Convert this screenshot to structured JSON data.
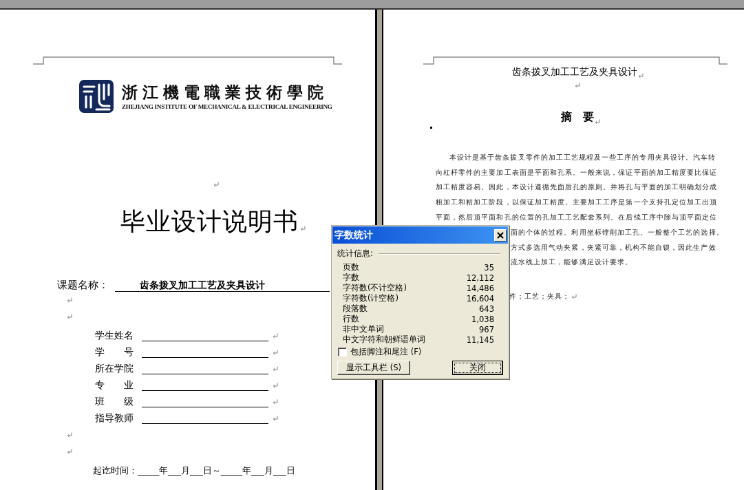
{
  "left_page": {
    "blocks": [
      {
        "kind": "logo",
        "name_cn": "浙江機電職業技術學院",
        "name_en": "ZHEJIANG INSTITUTE OF MECHANICAL & ELECTRICAL ENGINEERING"
      },
      {
        "kind": "center_mark"
      },
      {
        "kind": "title",
        "text": "毕业设计说明书"
      },
      {
        "kind": "topic",
        "label": "课题名称：",
        "value": "齿条拨叉加工工艺及夹具设计"
      },
      {
        "kind": "mark"
      },
      {
        "kind": "mark"
      },
      {
        "kind": "form",
        "fields": [
          {
            "label": "学生姓名"
          },
          {
            "label": "学　　号"
          },
          {
            "label": "所在学院"
          },
          {
            "label": "专　　业"
          },
          {
            "label": "班　　级"
          },
          {
            "label": "指导教师"
          }
        ]
      },
      {
        "kind": "mark"
      },
      {
        "kind": "mark"
      },
      {
        "kind": "dates",
        "text": "起讫时间：_____年___月___日～_____年___月___日"
      }
    ]
  },
  "right_page": {
    "title": "齿条拨叉加工工艺及夹具设计",
    "heading": "摘　要",
    "abstract_lines": [
      {
        "kind": "first",
        "text": "本设计是基于齿条拨叉零件的加工工艺规程及一些工序的专用夹具设计。汽车转"
      },
      {
        "kind": "full",
        "text": "向杠杆零件的主要加工表面是平面和孔系。一般来说，保证平面的加工精度要比保证"
      },
      {
        "kind": "full",
        "text": "加工精度容易。因此，本设计遵循先面后孔的原则。并将孔与平面的加工明确划分成"
      },
      {
        "kind": "full",
        "text": "粗加工和精加工阶段，以保证加工精度。主要加工工序是第一个支持孔定位加工出顶"
      },
      {
        "kind": "full",
        "text": "平面，然后顶平面和孔的位置的孔加工工艺配套系列。在后续工序中除与顶平面定位"
      },
      {
        "kind": "partial",
        "text": "面的个体的过程。利用坐标镗削加工孔。一般整个工艺的选择。"
      },
      {
        "kind": "partial",
        "text": "方式多选用气动夹紧，夹紧可靠，机构不能自锁，因此生产效"
      },
      {
        "kind": "partial",
        "text": "流水线上加工，能够满足设计要求。"
      }
    ],
    "keywords": "件；工艺；夹具；"
  },
  "dialog": {
    "title": "字数统计",
    "section": "统计信息:",
    "stats": [
      {
        "label": "页数",
        "value": "35"
      },
      {
        "label": "字数",
        "value": "12,112"
      },
      {
        "label": "字符数(不计空格)",
        "value": "14,486"
      },
      {
        "label": "字符数(计空格)",
        "value": "16,604"
      },
      {
        "label": "段落数",
        "value": "643"
      },
      {
        "label": "行数",
        "value": "1,038"
      },
      {
        "label": "非中文单词",
        "value": "967"
      },
      {
        "label": "中文字符和朝鲜语单词",
        "value": "11,145"
      }
    ],
    "checkbox": {
      "label": "包括脚注和尾注 (F)",
      "checked": false
    },
    "buttons": [
      {
        "label": "显示工具栏 (S)",
        "focused": false
      },
      {
        "label": "关闭",
        "focused": true
      }
    ]
  }
}
